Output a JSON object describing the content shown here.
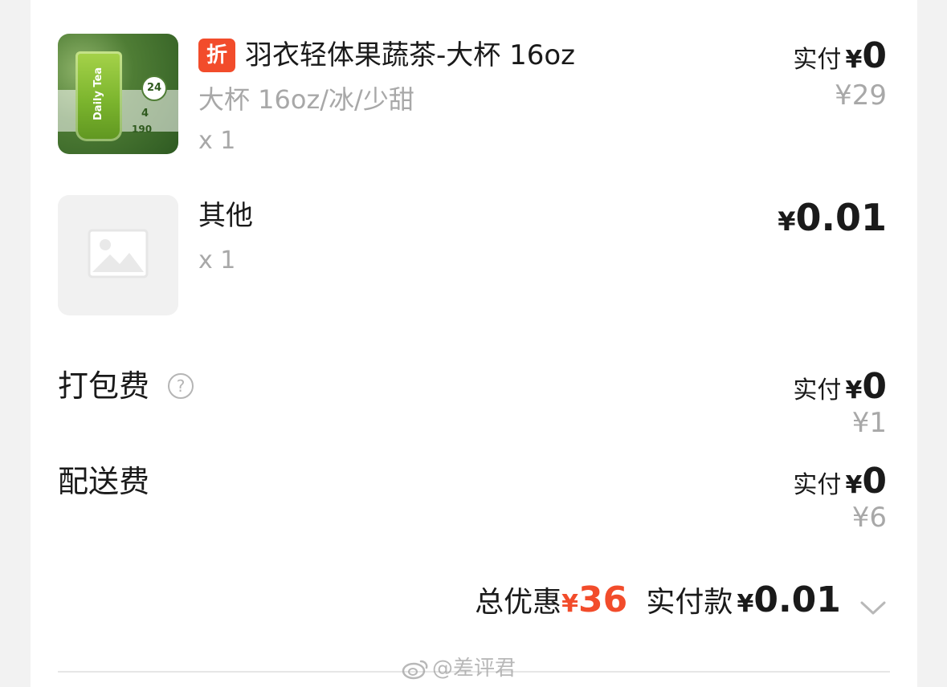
{
  "items": [
    {
      "discount_badge": "折",
      "name": "羽衣轻体果蔬茶-大杯 16oz",
      "spec": "大杯 16oz/冰/少甜",
      "qty": "x 1",
      "paid_label": "实付",
      "paid_currency": "¥",
      "paid_amount": "0",
      "original_price": "¥29",
      "image": {
        "brand_text": "Daily Tea",
        "badge": "24",
        "note_number": "4",
        "note_number2": "190"
      }
    },
    {
      "name": "其他",
      "qty": "x 1",
      "price_currency": "¥",
      "price_amount": "0.01"
    }
  ],
  "fees": [
    {
      "label": "打包费",
      "help_icon": "?",
      "paid_label": "实付",
      "paid_currency": "¥",
      "paid_amount": "0",
      "original_price": "¥1"
    },
    {
      "label": "配送费",
      "paid_label": "实付",
      "paid_currency": "¥",
      "paid_amount": "0",
      "original_price": "¥6"
    }
  ],
  "summary": {
    "discount_label": "总优惠",
    "discount_currency": "¥",
    "discount_amount": "36",
    "paid_label": "实付款",
    "paid_currency": "¥",
    "paid_amount": "0.01",
    "expand_icon": "chevron-down-icon"
  },
  "watermark": "@差评君",
  "colors": {
    "accent": "#f24c2b",
    "muted": "#a8a8a8",
    "text": "#1a1a1a"
  }
}
